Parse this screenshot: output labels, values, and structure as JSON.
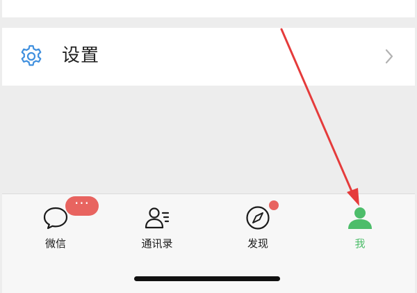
{
  "settings": {
    "label": "设置",
    "icon": "gear-icon",
    "chevron": "chevron-right-icon"
  },
  "tabbar": {
    "tabs": [
      {
        "label": "微信",
        "icon": "chat-bubble-icon",
        "badge": "···",
        "active": false
      },
      {
        "label": "通讯录",
        "icon": "contacts-icon",
        "active": false
      },
      {
        "label": "发现",
        "icon": "compass-icon",
        "badge_dot": true,
        "active": false
      },
      {
        "label": "我",
        "icon": "person-icon",
        "active": true
      }
    ]
  },
  "colors": {
    "accent_green": "#4dbd6a",
    "badge_red": "#e86460",
    "gear_blue": "#3f8fde",
    "arrow_red": "#e53b3b",
    "background": "#ededed"
  }
}
